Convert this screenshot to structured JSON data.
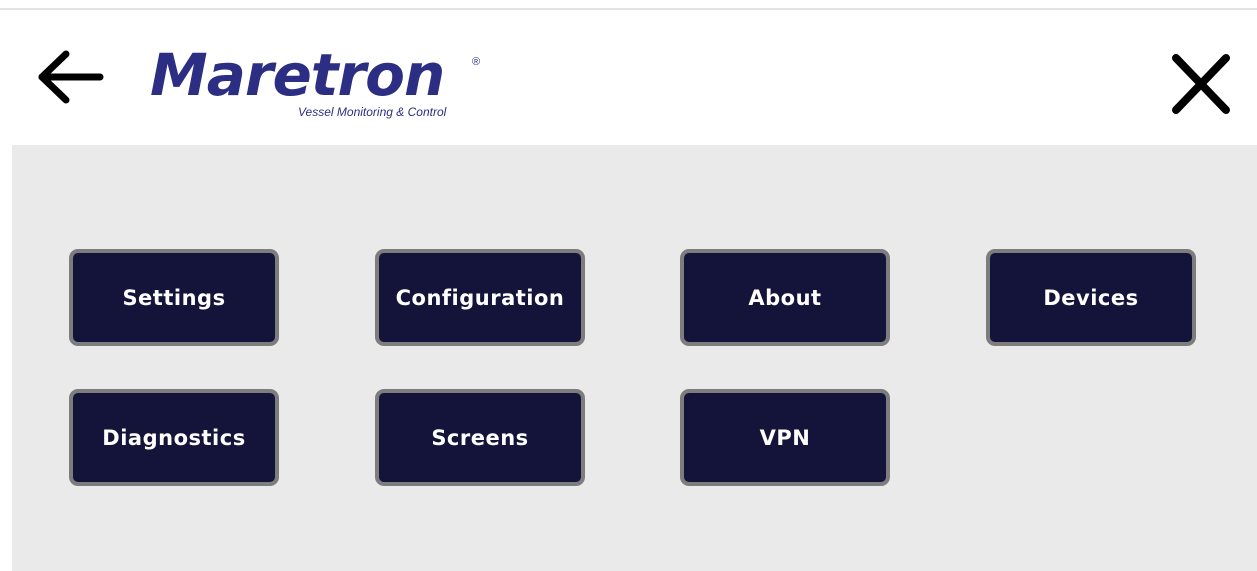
{
  "header": {
    "back_icon": "arrow-left-icon",
    "close_icon": "close-x-icon",
    "logo": {
      "wordmark": "Maretron",
      "registered_mark": "®",
      "tagline": "Vessel Monitoring & Control",
      "color": "#2b2e82"
    }
  },
  "menu": {
    "tile_color": "#14143a",
    "tile_border_color": "#7d7d7d",
    "panel_color": "#ebeaea",
    "items": [
      {
        "label": "Settings"
      },
      {
        "label": "Configuration"
      },
      {
        "label": "About"
      },
      {
        "label": "Devices"
      },
      {
        "label": "Diagnostics"
      },
      {
        "label": "Screens"
      },
      {
        "label": "VPN"
      }
    ]
  }
}
